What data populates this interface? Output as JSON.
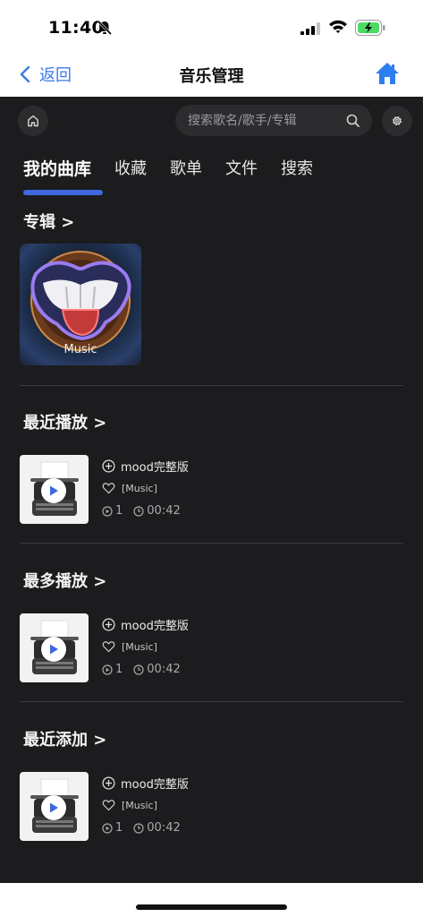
{
  "status_bar": {
    "time": "11:40"
  },
  "nav": {
    "back_label": "返回",
    "title": "音乐管理"
  },
  "search": {
    "placeholder": "搜索歌名/歌手/专辑"
  },
  "tabs": [
    {
      "label": "我的曲库"
    },
    {
      "label": "收藏"
    },
    {
      "label": "歌单"
    },
    {
      "label": "文件"
    },
    {
      "label": "搜索"
    }
  ],
  "sections": {
    "albums": {
      "title": "专辑 >",
      "album_name": "Music"
    },
    "recent_played": {
      "title": "最近播放 >"
    },
    "most_played": {
      "title": "最多播放 >"
    },
    "recent_added": {
      "title": "最近添加 >"
    }
  },
  "songs": [
    {
      "title": "mood完整版",
      "artist": "[Music]",
      "plays": "1",
      "duration": "00:42"
    },
    {
      "title": "mood完整版",
      "artist": "[Music]",
      "plays": "1",
      "duration": "00:42"
    },
    {
      "title": "mood完整版",
      "artist": "[Music]",
      "plays": "1",
      "duration": "00:42"
    }
  ],
  "colors": {
    "accent": "#3f67e0",
    "link": "#3a7ae8",
    "background": "#1c1c1e",
    "surface": "#2c2c2e"
  }
}
